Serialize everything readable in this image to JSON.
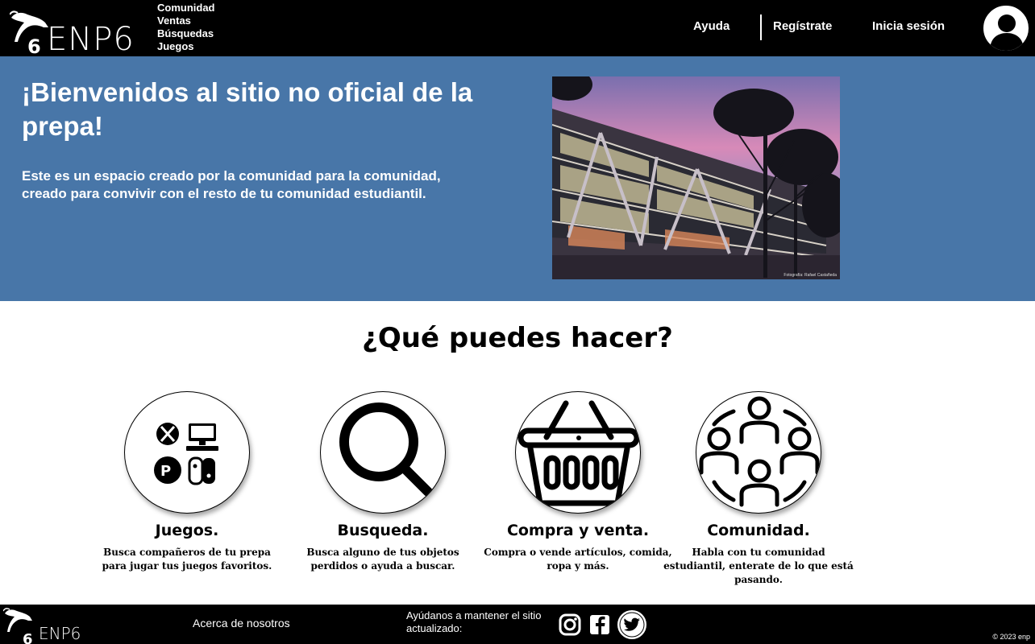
{
  "header": {
    "logo_text": "ENP6",
    "nav_left": [
      "Comunidad",
      "Ventas",
      "Búsquedas",
      "Juegos"
    ],
    "help_label": "Ayuda",
    "register_label": "Regístrate",
    "login_label": "Inicia sesión"
  },
  "hero": {
    "title": "¡Bienvenidos al sitio no oficial de la prepa!",
    "subtitle": "Este es un espacio creado por la comunidad para la comunidad, creado para convivir con el resto de tu comunidad estudiantil.",
    "photo_credit": "Fotografía: Rafael Castañeda"
  },
  "features": {
    "title": "¿Qué puedes hacer?",
    "items": [
      {
        "title": "Juegos.",
        "desc": "Busca compañeros de tu prepa para jugar tus juegos favoritos.",
        "icon": "games-icon"
      },
      {
        "title": "Busqueda.",
        "desc": "Busca alguno de tus objetos perdidos o ayuda a buscar.",
        "icon": "search-icon"
      },
      {
        "title": "Compra y venta.",
        "desc": "Compra o vende artículos, comida, ropa y más.",
        "icon": "basket-icon"
      },
      {
        "title": "Comunidad.",
        "desc": "Habla con tu comunidad estudiantil, enterate de lo que está pasando.",
        "icon": "community-icon"
      }
    ]
  },
  "footer": {
    "logo_text": "ENP6",
    "about_label": "Acerca de nosotros",
    "help_text": "Ayúdanos a mantener el sitio actualizado:",
    "social": [
      "instagram-icon",
      "facebook-icon",
      "twitter-icon"
    ],
    "copyright": "© 2023 enp"
  },
  "colors": {
    "header_bg": "#000000",
    "hero_bg": "#4876a8",
    "text_light": "#ffffff"
  }
}
